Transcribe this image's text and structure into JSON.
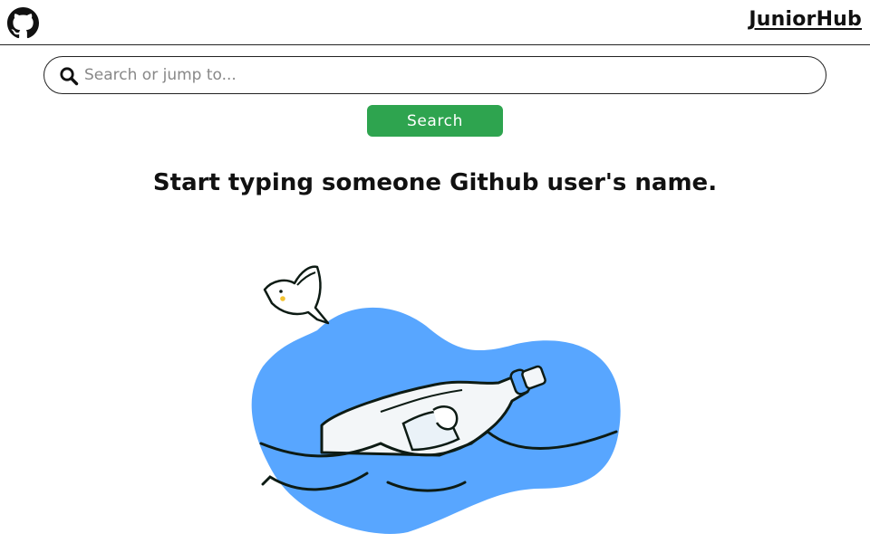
{
  "header": {
    "brand": "JuniorHub",
    "logo_icon": "github-octocat-icon"
  },
  "search": {
    "placeholder": "Search or jump to...",
    "value": "",
    "icon": "search-icon",
    "button_label": "Search"
  },
  "main": {
    "prompt": "Start typing someone Github user's name.",
    "illustration": "message-in-a-bottle-illustration"
  },
  "colors": {
    "accent_green": "#2ea44f",
    "water_blue": "#58a6ff",
    "text": "#111111",
    "border": "#222222"
  }
}
